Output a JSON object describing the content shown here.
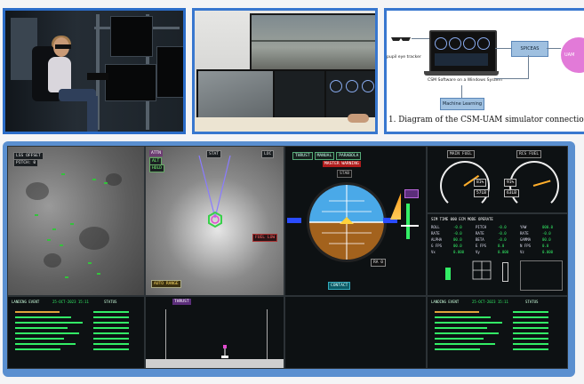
{
  "diagram": {
    "caption": "1. Diagram of the CSM-UAM simulator connections",
    "labels": {
      "tracker": "pupil eye tracker",
      "software": "CSM Software on a Windows System",
      "ml": "Machine Learning",
      "box_right": "SPICEAS",
      "pink": "UAM"
    }
  },
  "cockpit": {
    "left_top": {
      "tag1": "LSS OFFSET",
      "tag2": "PITCH: 0"
    },
    "center_top": {
      "tag_attn": "ATTN",
      "tag_alt": "ALT",
      "tag_hold": "HOLD",
      "tag_stat": "STAT",
      "tag_fuel": "FUEL LOW",
      "tag_auto": "AUTO RANGE",
      "tag_loc": "LOC"
    },
    "attitude": {
      "mode_buttons": [
        "THRUST",
        "MANUAL",
        "PARABOLA"
      ],
      "warning": "MASTER WARNING",
      "stab": "STAB",
      "rate_label": "RA 0",
      "contact": "CONTACT"
    },
    "fuel": {
      "main": "MAIN FUEL",
      "rcs": "RCS FUEL",
      "main_value": "57LB",
      "rcs_value": "63LB",
      "main_pct": "81%",
      "rcs_pct": "91%",
      "main_level": 0.81,
      "rcs_level": 0.91
    },
    "telemetry": {
      "header": "SIM TIME 000   ECM MODE  OPERATE",
      "rows": [
        [
          "ROLL",
          "-0.0",
          "PITCH",
          "-0.0",
          "YAW",
          "000.0"
        ],
        [
          "RATE",
          "-0.0",
          "RATE",
          "-0.0",
          "RATE",
          "-0.0"
        ],
        [
          "ALPHA",
          "00.0",
          "BETA",
          "-0.0",
          "GAMMA",
          "00.0"
        ],
        [
          "G FPS",
          "00.0",
          "E FPS",
          "0.0",
          "N FPS",
          "0.0"
        ],
        [
          "Vx",
          "0.000",
          "Vy",
          "0.000",
          "Vz",
          "0.000"
        ]
      ]
    },
    "events_left": {
      "title": "LANDING EVENT",
      "date": "25-OCT-2023 15:11",
      "status": "STATUS"
    },
    "events_right": {
      "title": "LANDING EVENT",
      "date": "25-OCT-2023 15:11",
      "status": "STATUS"
    },
    "center_bottom": {
      "tag": "THRUST"
    }
  },
  "colors": {
    "frame_blue": "#2b6cc8",
    "panel_blue": "#5a8fd0",
    "terrain_green": "#34c23c",
    "sky": "#4aa9e8",
    "ground": "#a3621d"
  }
}
